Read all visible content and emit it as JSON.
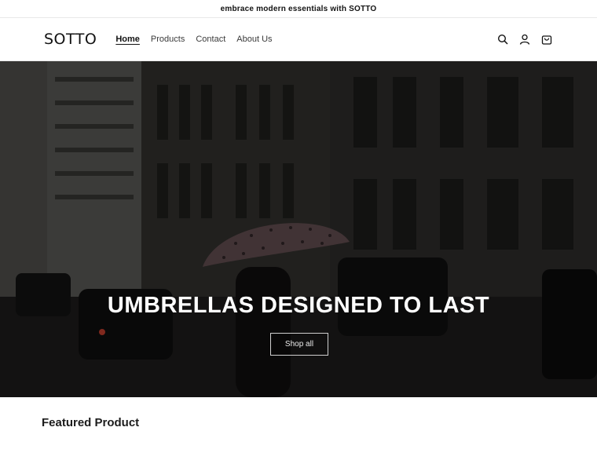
{
  "announcement": "embrace modern essentials with SOTTO",
  "logo": "SOTTO",
  "nav": [
    {
      "label": "Home",
      "active": true
    },
    {
      "label": "Products",
      "active": false
    },
    {
      "label": "Contact",
      "active": false
    },
    {
      "label": "About Us",
      "active": false
    }
  ],
  "header_icons": [
    "search-icon",
    "account-icon",
    "cart-icon"
  ],
  "hero": {
    "title": "UMBRELLAS DESIGNED TO LAST",
    "button_label": "Shop all"
  },
  "featured": {
    "heading": "Featured Product"
  }
}
